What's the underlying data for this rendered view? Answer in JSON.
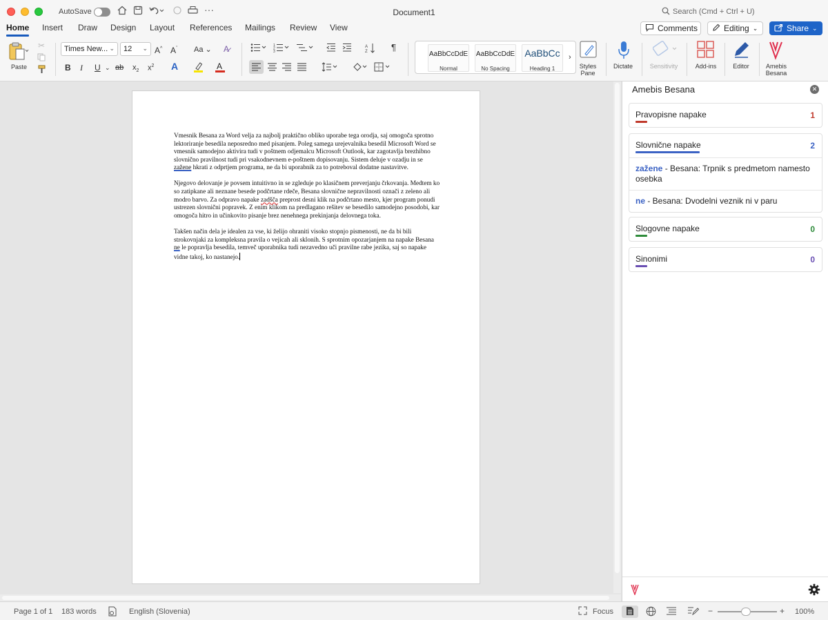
{
  "titlebar": {
    "autosave_label": "AutoSave",
    "document_title": "Document1",
    "search_placeholder": "Search (Cmd + Ctrl + U)"
  },
  "tabs": [
    {
      "label": "Home",
      "active": true
    },
    {
      "label": "Insert"
    },
    {
      "label": "Draw"
    },
    {
      "label": "Design"
    },
    {
      "label": "Layout"
    },
    {
      "label": "References"
    },
    {
      "label": "Mailings"
    },
    {
      "label": "Review"
    },
    {
      "label": "View"
    }
  ],
  "header_buttons": {
    "comments": "Comments",
    "editing": "Editing",
    "share": "Share"
  },
  "ribbon": {
    "paste_label": "Paste",
    "font_name": "Times New...",
    "font_size": "12",
    "styles": [
      {
        "sample": "AaBbCcDdE",
        "name": "Normal"
      },
      {
        "sample": "AaBbCcDdE",
        "name": "No Spacing"
      },
      {
        "sample": "AaBbCc",
        "name": "Heading 1"
      }
    ],
    "styles_pane": "Styles Pane",
    "dictate": "Dictate",
    "sensitivity": "Sensitivity",
    "addins": "Add-ins",
    "editor": "Editor",
    "amebis": "Amebis Besana",
    "accent": "#185abd"
  },
  "document": {
    "p1_a": "Vmesnik Besana za Word velja za najbolj praktično obliko uporabe tega orodja, saj omogoča sprotno lektoriranje besedila neposredno med pisanjem. Poleg samega urejevalnika besedil Microsoft Word se vmesnik samodejno aktivira tudi v poštnem odjemalcu Microsoft Outlook, kar zagotavlja brezhibno slovnično pravilnost tudi pri vsakodnevnem e-poštnem dopisovanju. Sistem deluje v ozadju in se ",
    "p1_err": "zažene",
    "p1_b": " hkrati z odprtjem programa, ne da bi uporabnik za to potreboval dodatne nastavitve.",
    "p2_a": "Njegovo delovanje je povsem intuitivno in se zgleduje po klasičnem preverjanju črkovanja. Medtem ko so zatipkane ali neznane besede podčrtane rdeče, Besana slovnične nepravilnosti označi z zeleno ali modro barvo. Za odpravo napake ",
    "p2_err": "zadšča",
    "p2_b": " preprost desni klik na podčrtano mesto, kjer program ponudi ustrezen slovnični popravek. Z enim klikom na predlagano rešitev se besedilo samodejno posodobi, kar omogoča hitro in učinkovito pisanje brez nenehnega prekinjanja delovnega toka.",
    "p3_a": "Takšen način dela je idealen za vse, ki želijo ohraniti visoko stopnjo pismenosti, ne da bi bili strokovnjaki za kompleksna pravila o vejicah ali sklonih. S sprotnim opozarjanjem na napake Besana ",
    "p3_err": "ne",
    "p3_b": " le popravlja besedila, temveč uporabnika tudi nezavedno uči pravilne rabe jezika, saj so napake vidne takoj, ko nastanejo."
  },
  "panel": {
    "title": "Amebis Besana",
    "categories": [
      {
        "label": "Pravopisne napake",
        "count": "1",
        "color": "#c0392b"
      },
      {
        "label": "Slovnične napake",
        "count": "2",
        "color": "#3b62c4",
        "items": [
          {
            "word": "zažene",
            "text": " - Besana: Trpnik s predmetom namesto osebka"
          },
          {
            "word": "ne",
            "text": " - Besana: Dvodelni veznik ni v paru"
          }
        ]
      },
      {
        "label": "Slogovne napake",
        "count": "0",
        "color": "#2e8b3a"
      },
      {
        "label": "Sinonimi",
        "count": "0",
        "color": "#6a4fb3"
      }
    ]
  },
  "statusbar": {
    "page": "Page 1 of 1",
    "words": "183 words",
    "language": "English (Slovenia)",
    "focus": "Focus",
    "zoom": "100%",
    "zoom_minus": "−",
    "zoom_plus": "+"
  }
}
